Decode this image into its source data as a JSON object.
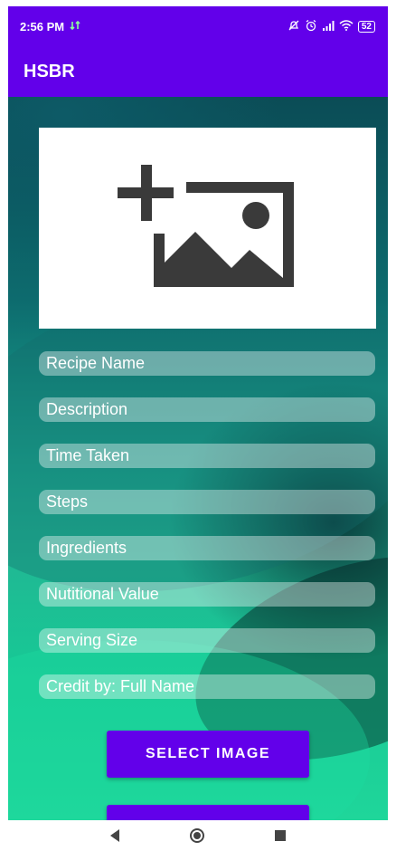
{
  "status_bar": {
    "time": "2:56 PM",
    "battery": "52"
  },
  "app_bar": {
    "title": "HSBR"
  },
  "image_placeholder": {
    "icon": "add-photo-icon"
  },
  "form": {
    "recipe_name": "Recipe Name",
    "description": "Description",
    "time_taken": "Time Taken",
    "steps": "Steps",
    "ingredients": "Ingredients",
    "nutritional_value": "Nutitional Value",
    "serving_size": "Serving Size",
    "credit_by": "Credit by: Full Name"
  },
  "buttons": {
    "select_image": "SELECT IMAGE",
    "second_button": ""
  },
  "colors": {
    "primary": "#6200ea",
    "field_bg": "rgba(255,255,255,0.38)",
    "image_box": "#ffffff"
  }
}
